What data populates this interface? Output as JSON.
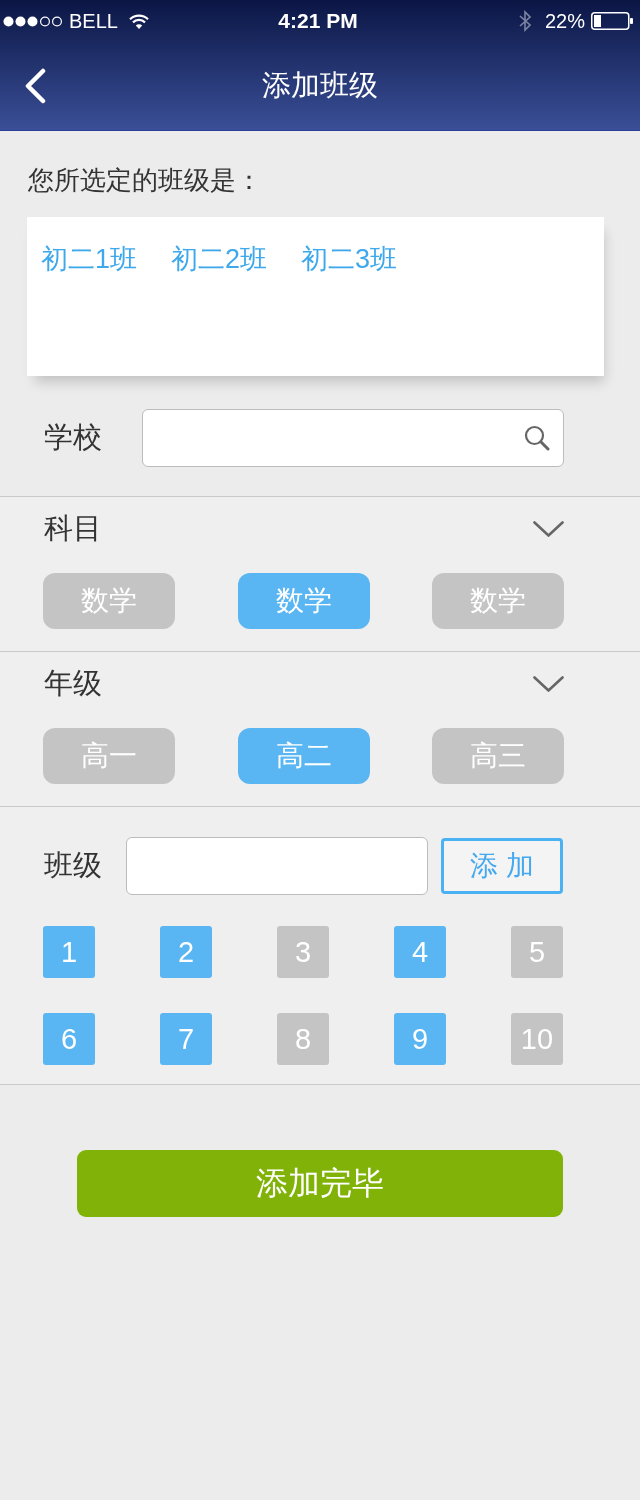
{
  "status_bar": {
    "carrier": "BELL",
    "time": "4:21 PM",
    "battery": "22%"
  },
  "nav_bar": {
    "title": "添加班级"
  },
  "selected_classes": {
    "label": "您所选定的班级是：",
    "items": [
      "初二1班",
      "初二2班",
      "初二3班"
    ]
  },
  "school": {
    "label": "学校"
  },
  "subject": {
    "label": "科目",
    "options": [
      {
        "label": "数学",
        "selected": false
      },
      {
        "label": "数学",
        "selected": true
      },
      {
        "label": "数学",
        "selected": false
      }
    ]
  },
  "grade": {
    "label": "年级",
    "options": [
      {
        "label": "高一",
        "selected": false
      },
      {
        "label": "高二",
        "selected": true
      },
      {
        "label": "高三",
        "selected": false
      }
    ]
  },
  "class_section": {
    "label": "班级",
    "add_button": "添 加",
    "numbers": [
      {
        "label": "1",
        "selected": true
      },
      {
        "label": "2",
        "selected": true
      },
      {
        "label": "3",
        "selected": false
      },
      {
        "label": "4",
        "selected": true
      },
      {
        "label": "5",
        "selected": false
      },
      {
        "label": "6",
        "selected": true
      },
      {
        "label": "7",
        "selected": true
      },
      {
        "label": "8",
        "selected": false
      },
      {
        "label": "9",
        "selected": true
      },
      {
        "label": "10",
        "selected": false
      }
    ]
  },
  "done_button": "添加完毕"
}
